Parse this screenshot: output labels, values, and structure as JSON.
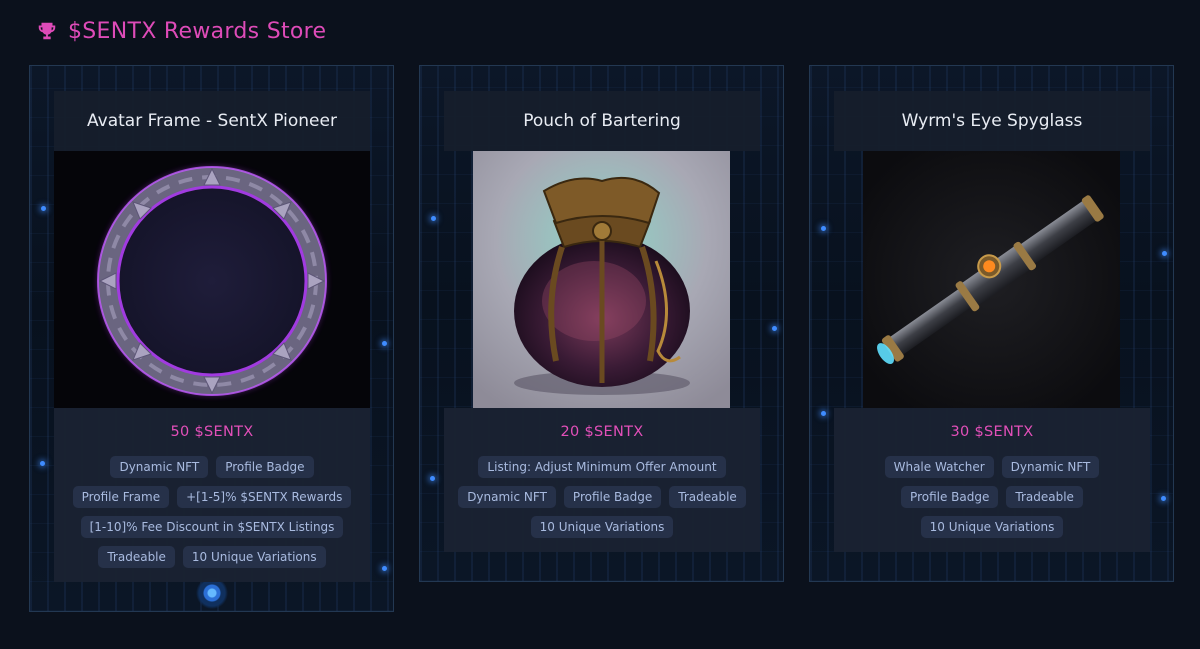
{
  "header": {
    "icon": "trophy-icon",
    "title": "$SENTX Rewards Store",
    "accent_color": "#de4bb8"
  },
  "items": [
    {
      "title": "Avatar Frame - SentX Pioneer",
      "image": "avatar-frame-image",
      "price": "50 $SENTX",
      "tags": [
        "Dynamic NFT",
        "Profile Badge",
        "Profile Frame",
        "+[1-5]% $SENTX Rewards",
        "[1-10]% Fee Discount in $SENTX Listings",
        "Tradeable",
        "10 Unique Variations"
      ]
    },
    {
      "title": "Pouch of Bartering",
      "image": "pouch-image",
      "price": "20 $SENTX",
      "tags": [
        "Listing: Adjust Minimum Offer Amount",
        "Dynamic NFT",
        "Profile Badge",
        "Tradeable",
        "10 Unique Variations"
      ]
    },
    {
      "title": "Wyrm's Eye Spyglass",
      "image": "spyglass-image",
      "price": "30 $SENTX",
      "tags": [
        "Whale Watcher",
        "Dynamic NFT",
        "Profile Badge",
        "Tradeable",
        "10 Unique Variations"
      ]
    }
  ]
}
